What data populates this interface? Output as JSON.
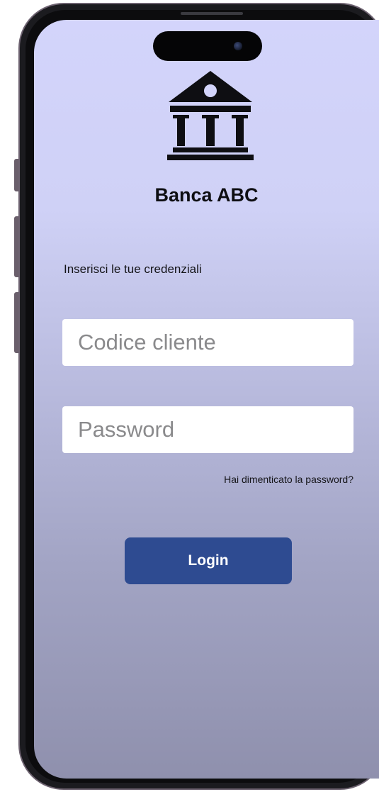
{
  "app": {
    "bank_name": "Banca ABC",
    "instructions": "Inserisci le tue credenziali",
    "logo_icon": "bank-building-icon"
  },
  "form": {
    "client_code": {
      "placeholder": "Codice cliente",
      "value": ""
    },
    "password": {
      "placeholder": "Password",
      "value": ""
    },
    "forgot_password_label": "Hai dimenticato la password?",
    "login_label": "Login"
  },
  "colors": {
    "accent": "#2e4b91",
    "screen_top": "#d3d4fb",
    "screen_bottom": "#8f90ad",
    "text_dark": "#0e0e12",
    "field_bg": "#ffffff",
    "placeholder": "#8a8a8c"
  }
}
